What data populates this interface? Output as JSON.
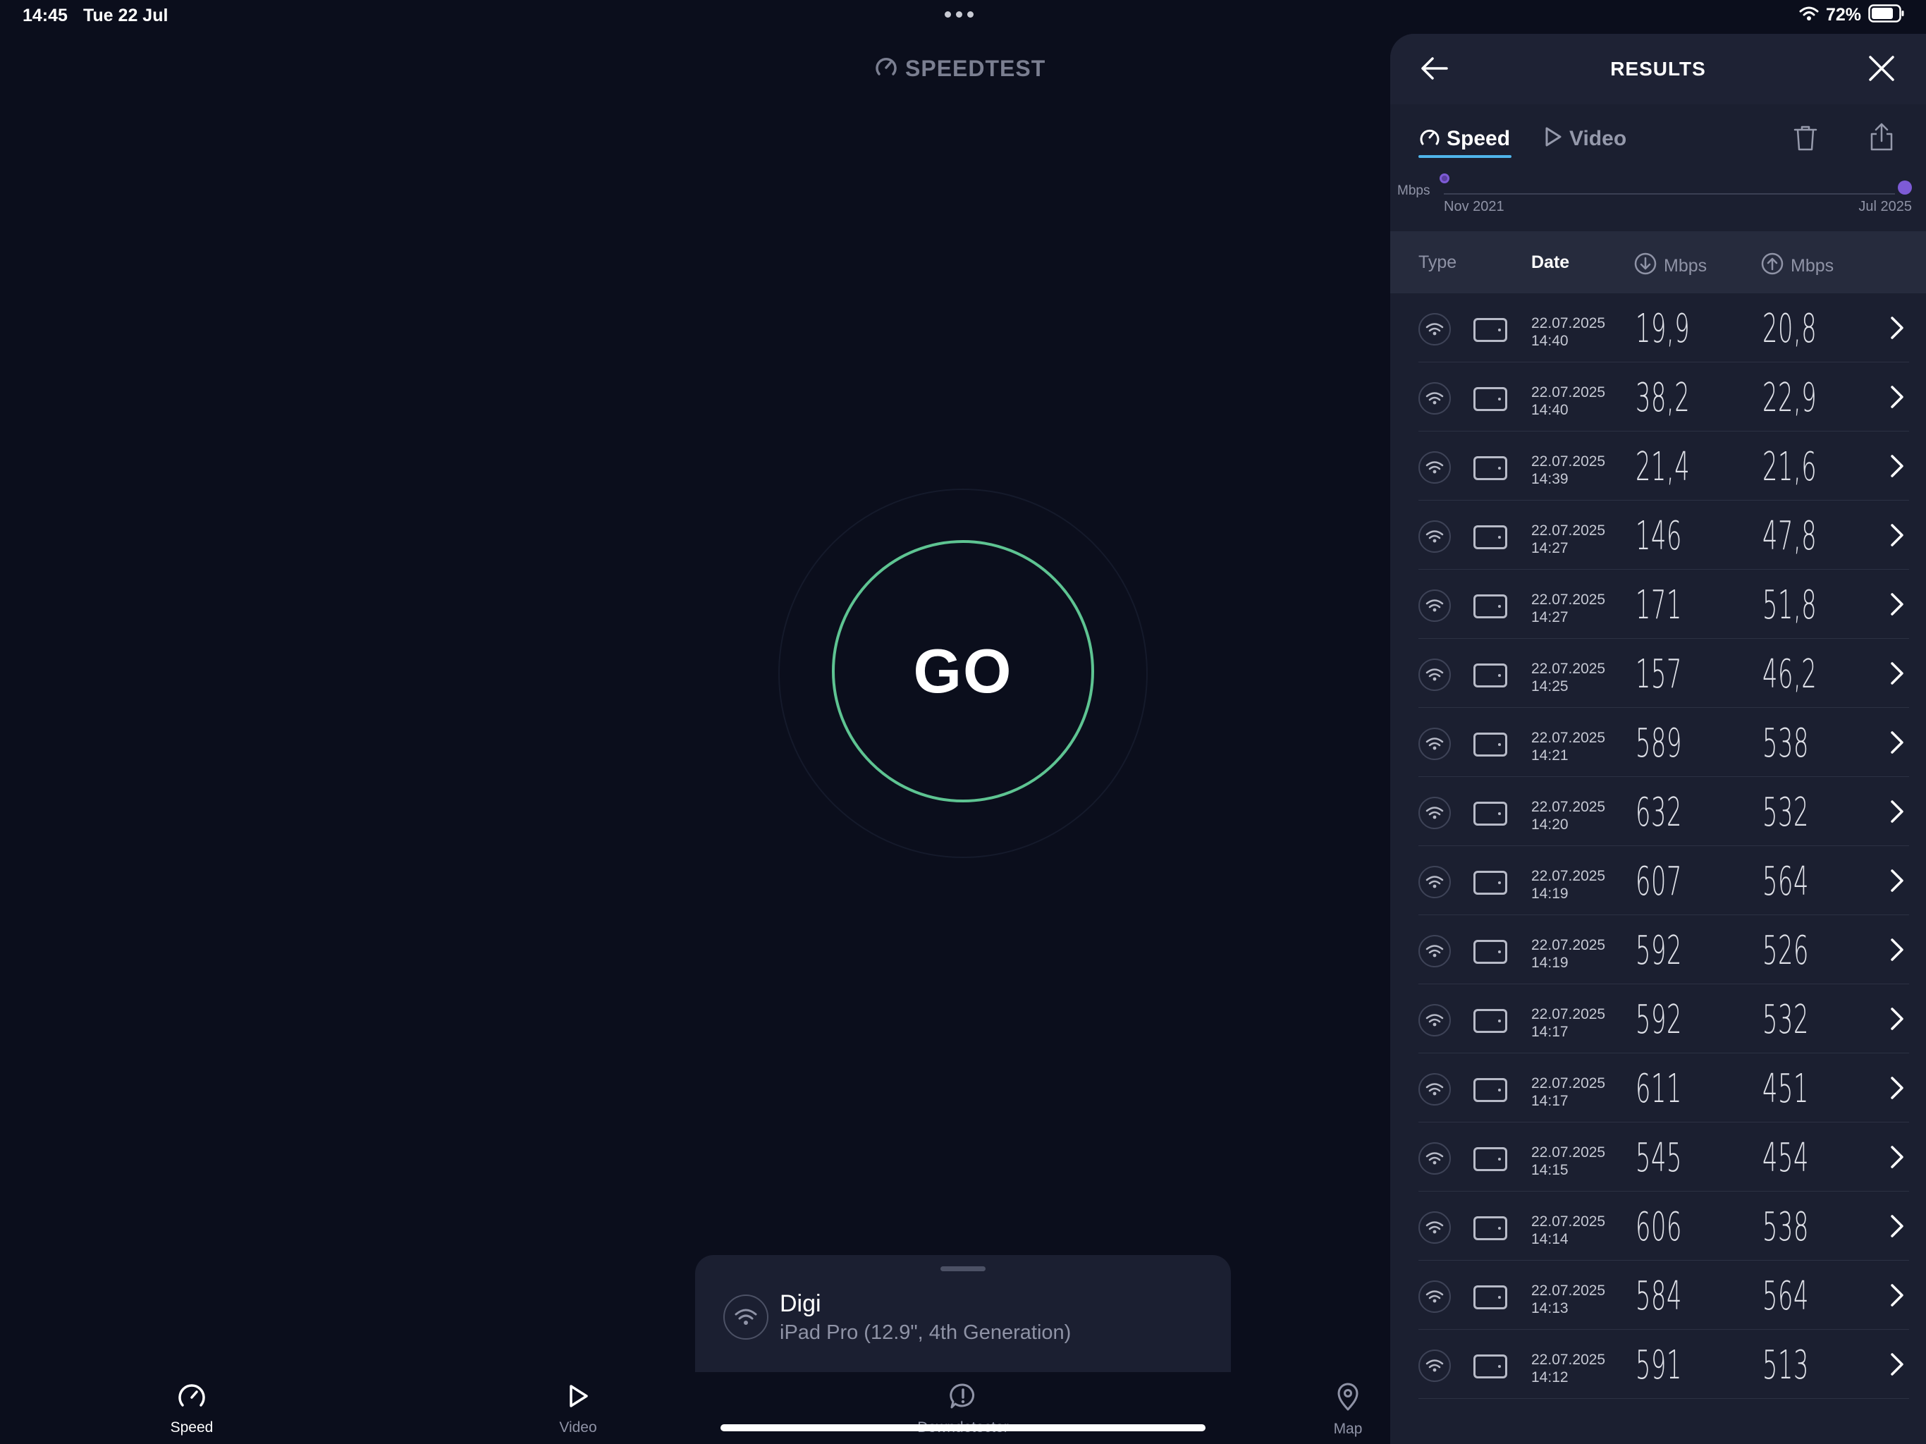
{
  "status": {
    "time": "14:45",
    "date": "Tue 22 Jul",
    "battery": "72%"
  },
  "brand": "SPEEDTEST",
  "go_label": "GO",
  "provider": {
    "name": "Digi",
    "device": "iPad Pro (12.9\", 4th Generation)"
  },
  "tabs": [
    {
      "label": "Speed",
      "icon": "speed-gauge-icon",
      "active": true
    },
    {
      "label": "Video",
      "icon": "play-icon",
      "active": false
    },
    {
      "label": "Downdetector",
      "icon": "alert-bubble-icon",
      "active": false
    },
    {
      "label": "Map",
      "icon": "map-pin-icon",
      "active": false
    }
  ],
  "results": {
    "title": "RESULTS",
    "segments": {
      "speed": "Speed",
      "video": "Video"
    },
    "timeline": {
      "unit": "Mbps",
      "start": "Nov 2021",
      "end": "Jul 2025"
    },
    "columns": {
      "type": "Type",
      "date": "Date",
      "download": "Mbps",
      "upload": "Mbps"
    },
    "rows": [
      {
        "date": "22.07.2025",
        "time": "14:40",
        "download": "19,9",
        "upload": "20,8"
      },
      {
        "date": "22.07.2025",
        "time": "14:40",
        "download": "38,2",
        "upload": "22,9"
      },
      {
        "date": "22.07.2025",
        "time": "14:39",
        "download": "21,4",
        "upload": "21,6"
      },
      {
        "date": "22.07.2025",
        "time": "14:27",
        "download": "146",
        "upload": "47,8"
      },
      {
        "date": "22.07.2025",
        "time": "14:27",
        "download": "171",
        "upload": "51,8"
      },
      {
        "date": "22.07.2025",
        "time": "14:25",
        "download": "157",
        "upload": "46,2"
      },
      {
        "date": "22.07.2025",
        "time": "14:21",
        "download": "589",
        "upload": "538"
      },
      {
        "date": "22.07.2025",
        "time": "14:20",
        "download": "632",
        "upload": "532"
      },
      {
        "date": "22.07.2025",
        "time": "14:19",
        "download": "607",
        "upload": "564"
      },
      {
        "date": "22.07.2025",
        "time": "14:19",
        "download": "592",
        "upload": "526"
      },
      {
        "date": "22.07.2025",
        "time": "14:17",
        "download": "592",
        "upload": "532"
      },
      {
        "date": "22.07.2025",
        "time": "14:17",
        "download": "611",
        "upload": "451"
      },
      {
        "date": "22.07.2025",
        "time": "14:15",
        "download": "545",
        "upload": "454"
      },
      {
        "date": "22.07.2025",
        "time": "14:14",
        "download": "606",
        "upload": "538"
      },
      {
        "date": "22.07.2025",
        "time": "14:13",
        "download": "584",
        "upload": "564"
      },
      {
        "date": "22.07.2025",
        "time": "14:12",
        "download": "591",
        "upload": "513"
      }
    ]
  },
  "colors": {
    "background": "#0b0e1c",
    "panel": "#1b1f30",
    "go_ring": "#5ec492",
    "accent_underline": "#4fb4ea",
    "timeline_dot": "#7d5bd6"
  }
}
